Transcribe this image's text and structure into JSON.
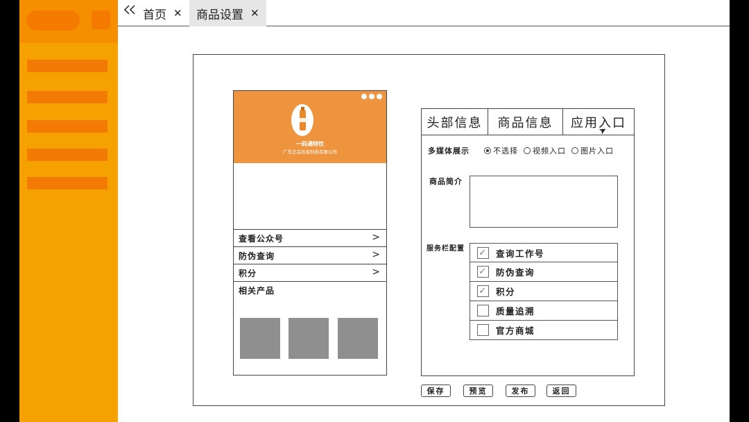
{
  "tabs": {
    "back_icon": "double-chevron-left",
    "home_label": "首页",
    "active_label": "商品设置",
    "close_glyph": "✕"
  },
  "phone": {
    "brand_name": "一码通特饮",
    "company": "广东正品信息科技有限公司",
    "rows": [
      {
        "label": "查看公众号"
      },
      {
        "label": "防伪查询"
      },
      {
        "label": "积分"
      }
    ],
    "related_title": "相关产品",
    "colors": {
      "header": "#ee943e",
      "thumb": "#8f8f8f"
    }
  },
  "panel": {
    "tabs": [
      "头部信息",
      "商品信息",
      "应用入口"
    ],
    "media_label": "多媒体展示",
    "media_options": [
      {
        "label": "不选择",
        "selected": true
      },
      {
        "label": "视频入口",
        "selected": false
      },
      {
        "label": "图片入口",
        "selected": false
      }
    ],
    "intro_label": "商品简介",
    "service_label": "服务栏配置",
    "services": [
      {
        "label": "查询工作号",
        "checked": true
      },
      {
        "label": "防伪查询",
        "checked": true
      },
      {
        "label": "积分",
        "checked": true
      },
      {
        "label": "质量追溯",
        "checked": false
      },
      {
        "label": "官方商城",
        "checked": false
      }
    ]
  },
  "buttons": {
    "save": "保存",
    "preview": "预览",
    "publish": "发布",
    "back": "返回"
  },
  "colors": {
    "sidebar": "#f5a200",
    "sidebar_bar": "#f27a05"
  }
}
